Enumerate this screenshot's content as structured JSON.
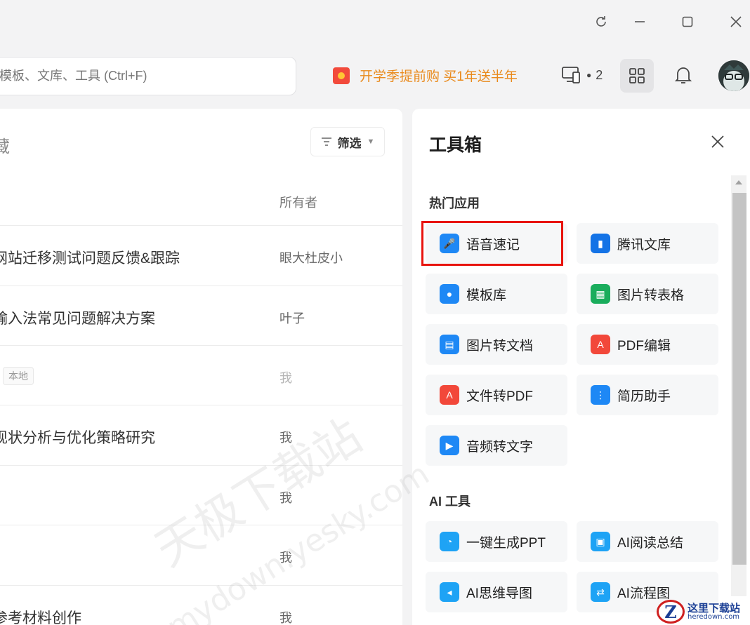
{
  "search": {
    "placeholder": "模板、文库、工具 (Ctrl+F)"
  },
  "promo": {
    "text": "开学季提前购 买1年送半年"
  },
  "devices": {
    "count": "2"
  },
  "docs": {
    "title": "藏",
    "filter_label": "筛选",
    "owner_header": "所有者",
    "rows": [
      {
        "name": "网站迁移测试问题反馈&跟踪",
        "owner": "眼大杜皮小"
      },
      {
        "name": "输入法常见问题解决方案",
        "owner": "叶子"
      },
      {
        "name": "",
        "tag": "本地",
        "owner": "我"
      },
      {
        "name": "现状分析与优化策略研究",
        "owner": "我"
      },
      {
        "name": "",
        "owner": "我"
      },
      {
        "name": "",
        "owner": "我"
      },
      {
        "name": "参考材料创作",
        "owner": "我"
      }
    ]
  },
  "toolbox": {
    "title": "工具箱",
    "sections": [
      {
        "label": "热门应用",
        "tools": [
          {
            "label": "语音速记",
            "icon": "voice-note-icon",
            "color": "#1e88f5"
          },
          {
            "label": "腾讯文库",
            "icon": "tencent-library-icon",
            "color": "#1473e6"
          },
          {
            "label": "模板库",
            "icon": "template-icon",
            "color": "#1e88f5"
          },
          {
            "label": "图片转表格",
            "icon": "image-to-table-icon",
            "color": "#1aad5c"
          },
          {
            "label": "图片转文档",
            "icon": "image-to-doc-icon",
            "color": "#1e88f5"
          },
          {
            "label": "PDF编辑",
            "icon": "pdf-edit-icon",
            "color": "#f2483a"
          },
          {
            "label": "文件转PDF",
            "icon": "file-to-pdf-icon",
            "color": "#f2483a"
          },
          {
            "label": "简历助手",
            "icon": "resume-icon",
            "color": "#1e88f5"
          },
          {
            "label": "音频转文字",
            "icon": "audio-to-text-icon",
            "color": "#1e88f5"
          }
        ]
      },
      {
        "label": "AI 工具",
        "tools": [
          {
            "label": "一键生成PPT",
            "icon": "ai-ppt-icon",
            "color": "#1ea3f5"
          },
          {
            "label": "AI阅读总结",
            "icon": "ai-summary-icon",
            "color": "#1ea3f5"
          },
          {
            "label": "AI思维导图",
            "icon": "ai-mindmap-icon",
            "color": "#1ea3f5"
          },
          {
            "label": "AI流程图",
            "icon": "ai-flowchart-icon",
            "color": "#1ea3f5"
          }
        ]
      }
    ]
  },
  "watermark": {
    "line1": "天极下载站",
    "line2": "mydown.yesky.com",
    "corner_a": "这里下载站",
    "corner_b": "heredown.com",
    "corner_letter": "Z"
  },
  "colors": {
    "accent": "#1e88f5",
    "promo": "#e98a1c",
    "highlight": "#e8140e"
  }
}
